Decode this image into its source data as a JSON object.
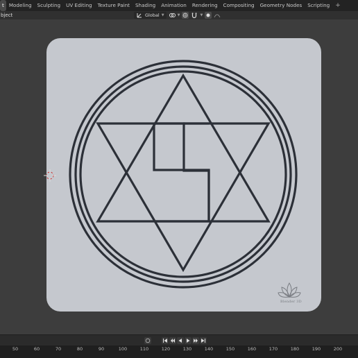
{
  "topbar": {
    "tabs": [
      {
        "label": "t",
        "active": true
      },
      {
        "label": "Modeling"
      },
      {
        "label": "Sculpting"
      },
      {
        "label": "UV Editing"
      },
      {
        "label": "Texture Paint"
      },
      {
        "label": "Shading"
      },
      {
        "label": "Animation"
      },
      {
        "label": "Rendering"
      },
      {
        "label": "Compositing"
      },
      {
        "label": "Geometry Nodes"
      },
      {
        "label": "Scripting"
      }
    ],
    "add_tab_label": "+"
  },
  "header": {
    "object_label": "bject",
    "orientation_value": "Global",
    "icons": [
      "transform-orientation-icon",
      "pivot-point-icon",
      "snap-icon",
      "magnet-icon",
      "proportional-editing-icon"
    ]
  },
  "viewport": {
    "plane_color": "#c5c8ce",
    "line_color": "#2c3038",
    "watermark_text": "Blender 3D"
  },
  "playback": {
    "buttons": [
      "keyframe-icon",
      "jump-start-icon",
      "prev-keyframe-icon",
      "play-reverse-icon",
      "play-icon",
      "next-keyframe-icon",
      "jump-end-icon"
    ]
  },
  "timeline": {
    "frames": [
      "50",
      "60",
      "70",
      "80",
      "90",
      "100",
      "110",
      "120",
      "130",
      "140",
      "150",
      "160",
      "170",
      "180",
      "190",
      "200"
    ]
  },
  "colors": {
    "background": "#3d3d3d",
    "topbar": "#232323",
    "active_tab": "#4a4a4a"
  }
}
